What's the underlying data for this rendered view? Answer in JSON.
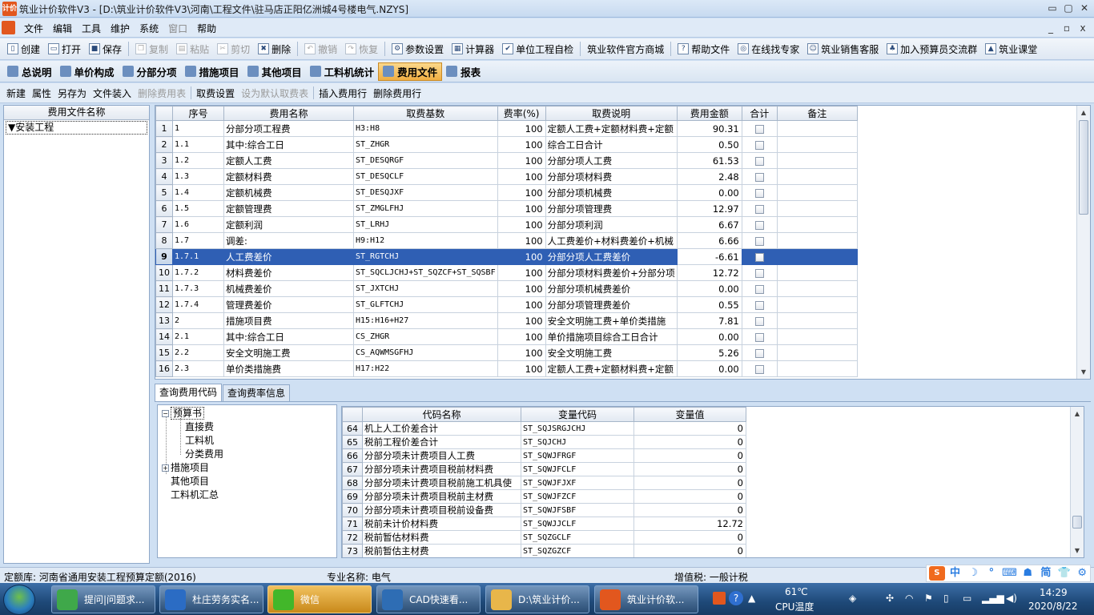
{
  "window": {
    "title": "筑业计价软件V3 - [D:\\筑业计价软件V3\\河南\\工程文件\\驻马店正阳亿洲城4号楼电气.NZYS]",
    "app_icon": "计价",
    "controls": [
      "▭",
      "▢",
      "✕"
    ],
    "mdi_controls": [
      "_",
      "▫",
      "x"
    ]
  },
  "menu": [
    "文件",
    "编辑",
    "工具",
    "维护",
    "系统",
    "窗口",
    "帮助"
  ],
  "menu_disabled": [
    "窗口"
  ],
  "toolbar": [
    {
      "label": "创建",
      "icon": "new-file-icon",
      "glyph": "▯"
    },
    {
      "label": "打开",
      "icon": "open-folder-icon",
      "glyph": "▭"
    },
    {
      "label": "保存",
      "icon": "save-icon",
      "glyph": "■"
    },
    {
      "label": "复制",
      "icon": "copy-icon",
      "glyph": "❐",
      "disabled": true
    },
    {
      "label": "粘贴",
      "icon": "paste-icon",
      "glyph": "▤",
      "disabled": true
    },
    {
      "label": "剪切",
      "icon": "cut-icon",
      "glyph": "✂",
      "disabled": true
    },
    {
      "label": "删除",
      "icon": "delete-icon",
      "glyph": "✖"
    },
    {
      "label": "撤销",
      "icon": "undo-icon",
      "glyph": "↶",
      "disabled": true
    },
    {
      "label": "恢复",
      "icon": "redo-icon",
      "glyph": "↷",
      "disabled": true
    },
    {
      "label": "参数设置",
      "icon": "settings-icon",
      "glyph": "⚙"
    },
    {
      "label": "计算器",
      "icon": "calculator-icon",
      "glyph": "▦"
    },
    {
      "label": "单位工程自检",
      "icon": "check-icon",
      "glyph": "✔"
    },
    {
      "label": "筑业软件官方商城",
      "icon": "",
      "glyph": ""
    },
    {
      "label": "帮助文件",
      "icon": "help-icon",
      "glyph": "?"
    },
    {
      "label": "在线找专家",
      "icon": "globe-icon",
      "glyph": "◎"
    },
    {
      "label": "筑业销售客服",
      "icon": "chat-icon",
      "glyph": "☺"
    },
    {
      "label": "加入预算员交流群",
      "icon": "group-icon",
      "glyph": "♣"
    },
    {
      "label": "筑业课堂",
      "icon": "graduation-icon",
      "glyph": "▲"
    }
  ],
  "module_tabs": [
    {
      "label": "总说明",
      "icon": "description-icon",
      "active": false
    },
    {
      "label": "单价构成",
      "icon": "price-icon",
      "active": false
    },
    {
      "label": "分部分项",
      "icon": "division-icon",
      "active": false
    },
    {
      "label": "措施项目",
      "icon": "measures-icon",
      "active": false
    },
    {
      "label": "其他项目",
      "icon": "other-items-icon",
      "active": false
    },
    {
      "label": "工料机统计",
      "icon": "statistics-icon",
      "active": false
    },
    {
      "label": "费用文件",
      "icon": "fee-file-icon",
      "active": true
    },
    {
      "label": "报表",
      "icon": "report-icon",
      "active": false
    }
  ],
  "sub_toolbar": [
    {
      "label": "新建",
      "disabled": false
    },
    {
      "label": "属性",
      "disabled": false
    },
    {
      "label": "另存为",
      "disabled": false
    },
    {
      "label": "文件装入",
      "disabled": false
    },
    {
      "label": "删除费用表",
      "disabled": true
    },
    {
      "label": "取费设置",
      "disabled": false
    },
    {
      "label": "设为默认取费表",
      "disabled": true
    },
    {
      "label": "插入费用行",
      "disabled": false
    },
    {
      "label": "删除费用行",
      "disabled": false
    }
  ],
  "left_panel": {
    "header": "费用文件名称",
    "items": [
      "▼安装工程"
    ]
  },
  "fee_table": {
    "columns": [
      "序号",
      "费用名称",
      "取费基数",
      "费率(%)",
      "取费说明",
      "费用金额",
      "合计",
      "备注"
    ],
    "selected_row": 9,
    "rows": [
      {
        "n": "1",
        "seq": "1",
        "name": "分部分项工程费",
        "base": "H3:H8",
        "rate": "100",
        "desc": "定额人工费+定额材料费+定额",
        "amount": "90.31"
      },
      {
        "n": "2",
        "seq": "1.1",
        "name": "其中:综合工日",
        "base": "ST_ZHGR",
        "rate": "100",
        "desc": "综合工日合计",
        "amount": "0.50"
      },
      {
        "n": "3",
        "seq": "1.2",
        "name": "定额人工费",
        "base": "ST_DESQRGF",
        "rate": "100",
        "desc": "分部分项人工费",
        "amount": "61.53"
      },
      {
        "n": "4",
        "seq": "1.3",
        "name": "定额材料费",
        "base": "ST_DESQCLF",
        "rate": "100",
        "desc": "分部分项材料费",
        "amount": "2.48"
      },
      {
        "n": "5",
        "seq": "1.4",
        "name": "定额机械费",
        "base": "ST_DESQJXF",
        "rate": "100",
        "desc": "分部分项机械费",
        "amount": "0.00"
      },
      {
        "n": "6",
        "seq": "1.5",
        "name": "定额管理费",
        "base": "ST_ZMGLFHJ",
        "rate": "100",
        "desc": "分部分项管理费",
        "amount": "12.97"
      },
      {
        "n": "7",
        "seq": "1.6",
        "name": "定额利润",
        "base": "ST_LRHJ",
        "rate": "100",
        "desc": "分部分项利润",
        "amount": "6.67"
      },
      {
        "n": "8",
        "seq": "1.7",
        "name": "调差:",
        "base": "H9:H12",
        "rate": "100",
        "desc": "人工费差价+材料费差价+机械",
        "amount": "6.66"
      },
      {
        "n": "9",
        "seq": "1.7.1",
        "name": "人工费差价",
        "base": "ST_RGTCHJ",
        "rate": "100",
        "desc": "分部分项人工费差价",
        "amount": "-6.61"
      },
      {
        "n": "10",
        "seq": "1.7.2",
        "name": "材料费差价",
        "base": "ST_SQCLJCHJ+ST_SQZCF+ST_SQSBF",
        "rate": "100",
        "desc": "分部分项材料费差价+分部分项",
        "amount": "12.72"
      },
      {
        "n": "11",
        "seq": "1.7.3",
        "name": "机械费差价",
        "base": "ST_JXTCHJ",
        "rate": "100",
        "desc": "分部分项机械费差价",
        "amount": "0.00"
      },
      {
        "n": "12",
        "seq": "1.7.4",
        "name": "管理费差价",
        "base": "ST_GLFTCHJ",
        "rate": "100",
        "desc": "分部分项管理费差价",
        "amount": "0.55"
      },
      {
        "n": "13",
        "seq": "2",
        "name": "措施项目费",
        "base": "H15:H16+H27",
        "rate": "100",
        "desc": "安全文明施工费+单价类措施",
        "amount": "7.81"
      },
      {
        "n": "14",
        "seq": "2.1",
        "name": "其中:综合工日",
        "base": "CS_ZHGR",
        "rate": "100",
        "desc": "单价措施项目综合工日合计",
        "amount": "0.00"
      },
      {
        "n": "15",
        "seq": "2.2",
        "name": "安全文明施工费",
        "base": "CS_AQWMSGFHJ",
        "rate": "100",
        "desc": "安全文明施工费",
        "amount": "5.26"
      },
      {
        "n": "16",
        "seq": "2.3",
        "name": "单价类措施费",
        "base": "H17:H22",
        "rate": "100",
        "desc": "定额人工费+定额材料费+定额",
        "amount": "0.00"
      }
    ]
  },
  "bottom_tabs": [
    {
      "label": "查询费用代码",
      "active": true
    },
    {
      "label": "查询费率信息",
      "active": false
    }
  ],
  "code_tree": [
    {
      "label": "预算书",
      "level": 0,
      "toggle": "−",
      "focus": true
    },
    {
      "label": "直接费",
      "level": 1
    },
    {
      "label": "工料机",
      "level": 1
    },
    {
      "label": "分类费用",
      "level": 1
    },
    {
      "label": "措施项目",
      "level": 0,
      "toggle": "+"
    },
    {
      "label": "其他项目",
      "level": 0
    },
    {
      "label": "工料机汇总",
      "level": 0
    }
  ],
  "code_table": {
    "columns": [
      "代码名称",
      "变量代码",
      "变量值"
    ],
    "rows": [
      {
        "n": "64",
        "name": "机上人工价差合计",
        "code": "ST_SQJSRGJCHJ",
        "value": "0"
      },
      {
        "n": "65",
        "name": "税前工程价差合计",
        "code": "ST_SQJCHJ",
        "value": "0"
      },
      {
        "n": "66",
        "name": "分部分项未计费项目人工费",
        "code": "ST_SQWJFRGF",
        "value": "0"
      },
      {
        "n": "67",
        "name": "分部分项未计费项目税前材料费",
        "code": "ST_SQWJFCLF",
        "value": "0"
      },
      {
        "n": "68",
        "name": "分部分项未计费项目税前施工机具使",
        "code": "ST_SQWJFJXF",
        "value": "0"
      },
      {
        "n": "69",
        "name": "分部分项未计费项目税前主材费",
        "code": "ST_SQWJFZCF",
        "value": "0"
      },
      {
        "n": "70",
        "name": "分部分项未计费项目税前设备费",
        "code": "ST_SQWJFSBF",
        "value": "0"
      },
      {
        "n": "71",
        "name": "税前未计价材料费",
        "code": "ST_SQWJJCLF",
        "value": "12.72"
      },
      {
        "n": "72",
        "name": "税前暂估材料费",
        "code": "ST_SQZGCLF",
        "value": "0"
      },
      {
        "n": "73",
        "name": "税前暂估主材费",
        "code": "ST_SQZGZCF",
        "value": "0"
      }
    ]
  },
  "status": {
    "quota": "定额库: 河南省通用安装工程预算定额(2016)",
    "specialty": "专业名称: 电气",
    "vat": "增值税: 一般计税"
  },
  "ime": [
    "中",
    "☽",
    "°",
    "⌨",
    "☗",
    "简",
    "👕",
    "⚙"
  ],
  "taskbar": {
    "items": [
      {
        "label": "提问|问题求...",
        "icon_color": "#3fa84a",
        "highlight": false
      },
      {
        "label": "杜庄劳务实名...",
        "icon_color": "#2b6cc4",
        "highlight": false
      },
      {
        "label": "微信",
        "icon_color": "#42b72a",
        "highlight": true
      },
      {
        "label": "CAD快速看...",
        "icon_color": "#2e6db4",
        "highlight": false
      },
      {
        "label": "D:\\筑业计价...",
        "icon_color": "#e8b64a",
        "highlight": false
      },
      {
        "label": "筑业计价软...",
        "icon_color": "#e2571e",
        "highlight": false
      }
    ],
    "temperature": "61℃",
    "cpu_label": "CPU温度",
    "time": "14:29",
    "date": "2020/8/22"
  }
}
